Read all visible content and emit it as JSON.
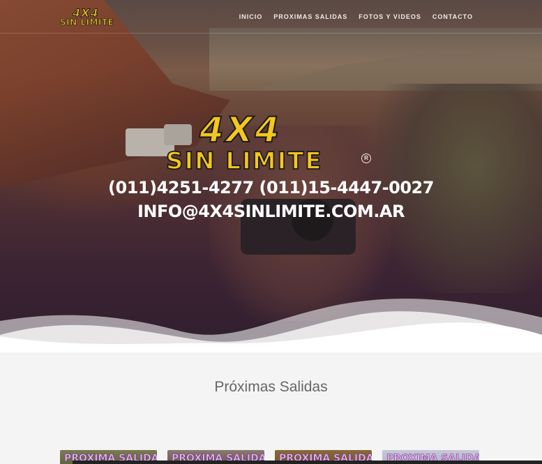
{
  "brand": {
    "name_top": "4X4",
    "name_bottom": "SIN LIMITE",
    "registered": "R",
    "accent_color": "#f5c61c"
  },
  "nav": {
    "items": [
      {
        "label": "INICIO"
      },
      {
        "label": "PROXIMAS SALIDAS"
      },
      {
        "label": "FOTOS Y VIDEOS"
      },
      {
        "label": "CONTACTO"
      }
    ]
  },
  "hero": {
    "phones": "(011)4251-4277 (011)15-4447-0027",
    "email": "INFO@4X4SINLIMITE.COM.AR"
  },
  "section": {
    "title": "Próximas Salidas",
    "cards": [
      {
        "label": "PROXIMA SALIDA"
      },
      {
        "label": "PROXIMA SALIDA"
      },
      {
        "label": "PROXIMA SALIDA"
      },
      {
        "label": "PROXIMA SALIDA"
      }
    ]
  }
}
